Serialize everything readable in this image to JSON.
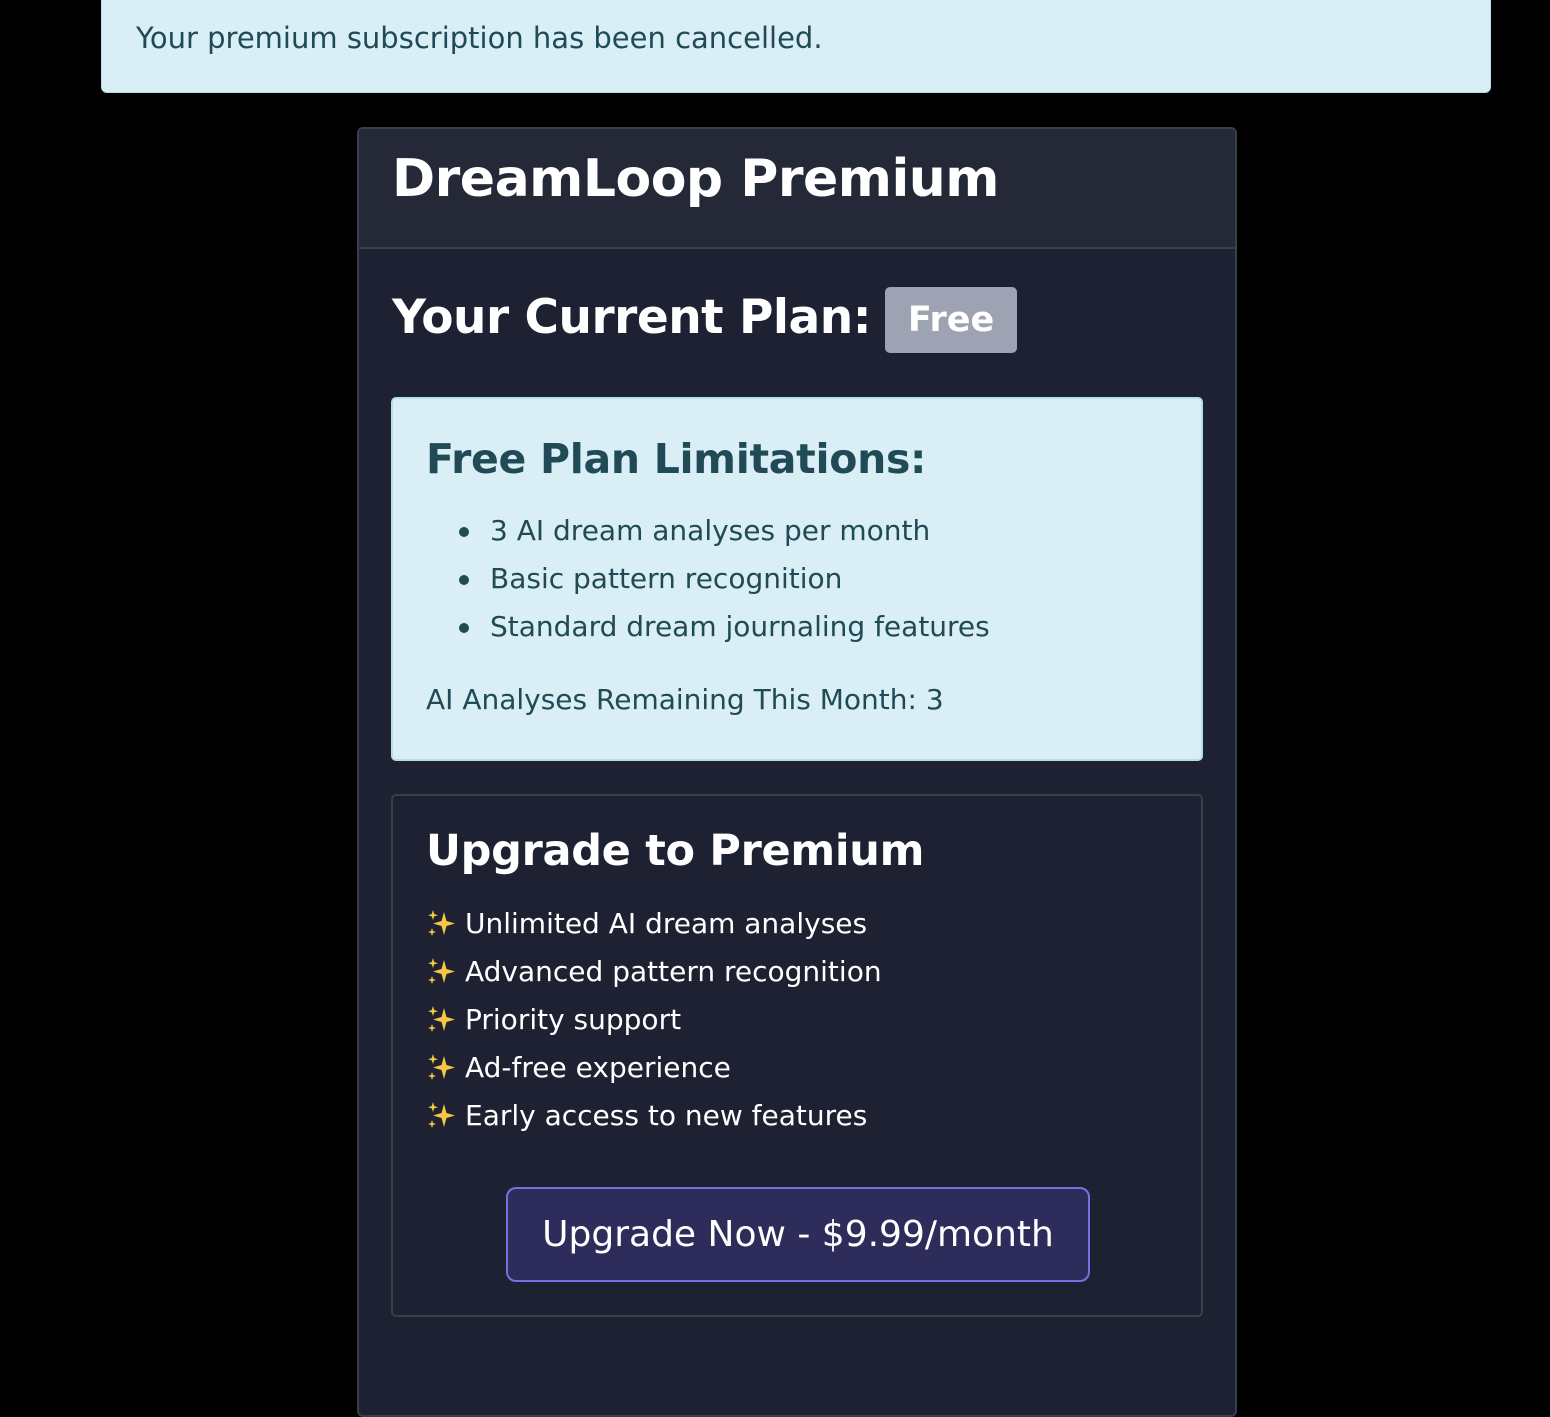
{
  "alert": {
    "message": "Your premium subscription has been cancelled."
  },
  "card": {
    "title": "DreamLoop Premium",
    "plan_label": "Your Current Plan:",
    "plan_badge": "Free"
  },
  "limitations": {
    "title": "Free Plan Limitations:",
    "items": [
      "3 AI dream analyses per month",
      "Basic pattern recognition",
      "Standard dream journaling features"
    ],
    "remaining": "AI Analyses Remaining This Month: 3"
  },
  "upgrade": {
    "title": "Upgrade to Premium",
    "features": [
      {
        "icon": "sparkles-icon",
        "label": "Unlimited AI dream analyses"
      },
      {
        "icon": "sparkles-icon",
        "label": "Advanced pattern recognition"
      },
      {
        "icon": "sparkles-icon",
        "label": "Priority support"
      },
      {
        "icon": "sparkles-icon",
        "label": "Ad-free experience"
      },
      {
        "icon": "sparkles-icon",
        "label": "Early access to new features"
      }
    ],
    "button_label": "Upgrade Now - $9.99/month"
  },
  "colors": {
    "page_bg": "#000000",
    "alert_bg": "#d9eef5",
    "alert_text": "#1f4a56",
    "card_bg": "#1e2132",
    "badge_bg": "#9ea3b3",
    "button_bg": "#2e2c5a",
    "button_border": "#7a6ee0",
    "sparkle": "#f5c842"
  }
}
